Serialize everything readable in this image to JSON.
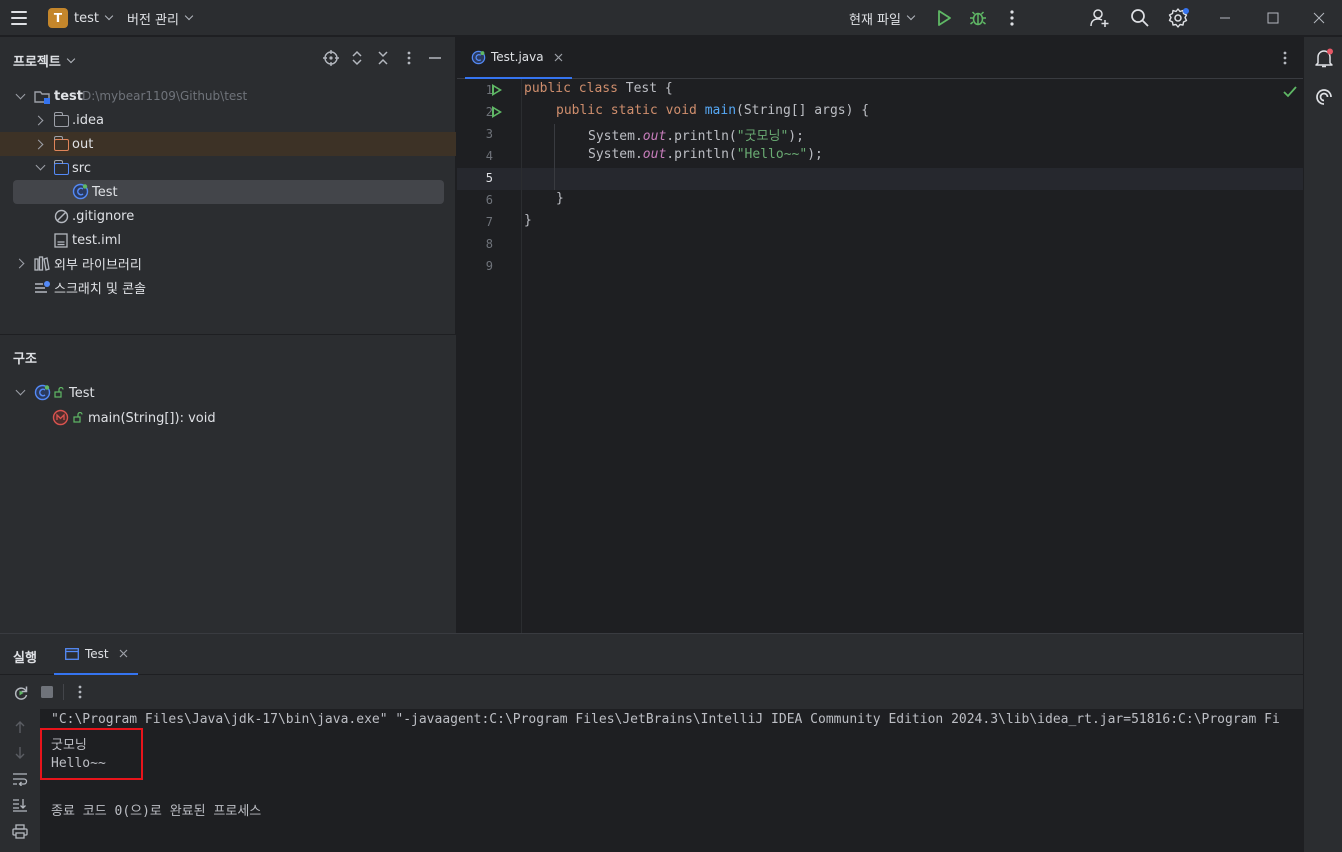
{
  "titlebar": {
    "project_badge": "T",
    "project_name": "test",
    "vcs_menu": "버전 관리",
    "run_config": "현재 파일"
  },
  "project_panel": {
    "title": "프로젝트",
    "root": {
      "name": "test",
      "path": "D:\\mybear1109\\Github\\test"
    },
    "items": [
      {
        "label": ".idea"
      },
      {
        "label": "out"
      },
      {
        "label": "src"
      },
      {
        "label": "Test"
      },
      {
        "label": ".gitignore"
      },
      {
        "label": "test.iml"
      },
      {
        "label": "외부 라이브러리"
      },
      {
        "label": "스크래치 및 콘솔"
      }
    ]
  },
  "structure_panel": {
    "title": "구조",
    "items": [
      {
        "label": "Test"
      },
      {
        "label": "main(String[]): void"
      }
    ]
  },
  "editor": {
    "tab_label": "Test.java",
    "line_numbers": [
      "1",
      "2",
      "3",
      "4",
      "5",
      "6",
      "7",
      "8",
      "9"
    ],
    "code": {
      "l1_kw": "public class",
      "l1_rest": " Test {",
      "l2_kw": "public static void",
      "l2_fn": "main",
      "l2_rest": "(String[] args) {",
      "l3_a": "System.",
      "l3_field": "out",
      "l3_b": ".println(",
      "l3_str": "\"굿모닝\"",
      "l3_c": ");",
      "l4_a": "System.",
      "l4_field": "out",
      "l4_b": ".println(",
      "l4_str": "\"Hello~~\"",
      "l4_c": ");",
      "l6": "}",
      "l7": "}"
    }
  },
  "run_panel": {
    "title": "실행",
    "tab_label": "Test",
    "console": [
      "\"C:\\Program Files\\Java\\jdk-17\\bin\\java.exe\" \"-javaagent:C:\\Program Files\\JetBrains\\IntelliJ IDEA Community Edition 2024.3\\lib\\idea_rt.jar=51816:C:\\Program Fi",
      "굿모닝",
      "Hello~~",
      "",
      "종료 코드 0(으)로 완료된 프로세스"
    ]
  },
  "colors": {
    "accent": "#3574f0",
    "run_green": "#5fb865",
    "highlight_red": "#e8141b",
    "notification_dot": "#e55765"
  }
}
